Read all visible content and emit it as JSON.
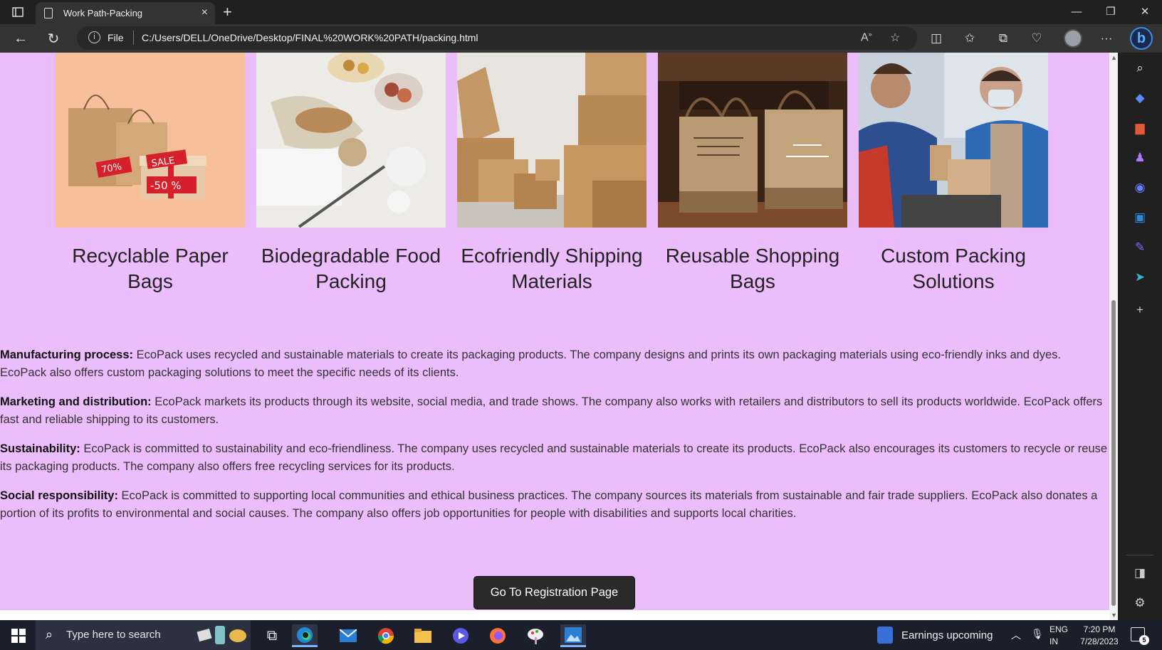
{
  "browser": {
    "tab_title": "Work Path-Packing",
    "scheme_label": "File",
    "url": "C:/Users/DELL/OneDrive/Desktop/FINAL%20WORK%20PATH/packing.html",
    "new_tab_glyph": "+",
    "close_tab_glyph": "×",
    "icons": [
      "tab-actions-icon",
      "back-icon",
      "refresh-icon",
      "info-icon",
      "read-aloud-icon",
      "favorite-star-icon",
      "split-screen-icon",
      "favorites-icon",
      "collections-icon",
      "browser-essentials-icon",
      "profile-avatar",
      "more-icon",
      "bing-copilot-icon"
    ]
  },
  "products": [
    {
      "caption": "Recyclable Paper Bags",
      "image": "paper-bags-sale-image",
      "tag_sale": "SALE",
      "tag_70": "70%",
      "tag_50": "-50 %"
    },
    {
      "caption": "Biodegradable Food Packing",
      "image": "food-packing-image"
    },
    {
      "caption": "Ecofriendly Shipping Materials",
      "image": "cardboard-boxes-image"
    },
    {
      "caption": "Reusable Shopping Bags",
      "image": "jute-shopping-bags-image"
    },
    {
      "caption": "Custom Packing Solutions",
      "image": "workers-packing-image"
    }
  ],
  "sections": [
    {
      "heading": "Manufacturing process:",
      "text": " EcoPack uses recycled and sustainable materials to create its packaging products. The company designs and prints its own packaging materials using eco-friendly inks and dyes. EcoPack also offers custom packaging solutions to meet the specific needs of its clients."
    },
    {
      "heading": "Marketing and distribution:",
      "text": " EcoPack markets its products through its website, social media, and trade shows. The company also works with retailers and distributors to sell its products worldwide. EcoPack offers fast and reliable shipping to its customers."
    },
    {
      "heading": "Sustainability:",
      "text": " EcoPack is committed to sustainability and eco-friendliness. The company uses recycled and sustainable materials to create its products. EcoPack also encourages its customers to recycle or reuse its packaging products. The company also offers free recycling services for its products."
    },
    {
      "heading": "Social responsibility:",
      "text": " EcoPack is committed to supporting local communities and ethical business practices. The company sources its materials from sustainable and fair trade suppliers. EcoPack also donates a portion of its profits to environmental and social causes. The company also offers job opportunities for people with disabilities and supports local charities."
    }
  ],
  "registration_button": "Go To Registration Page",
  "colors": {
    "page_bg": "#ecbdfb",
    "button_bg": "#2a2a2a",
    "browser_chrome": "#333333"
  },
  "sidebar_icons": [
    "search-icon",
    "shopping-tag-icon",
    "tools-icon",
    "games-icon",
    "copilot-icon",
    "outlook-icon",
    "drop-icon",
    "send-icon",
    "add-icon",
    "sidebar-toggle-icon",
    "settings-icon"
  ],
  "taskbar": {
    "search_placeholder": "Type here to search",
    "news_text": "Earnings upcoming",
    "lang_line1": "ENG",
    "lang_line2": "IN",
    "time": "7:20 PM",
    "date": "7/28/2023",
    "notification_count": "5",
    "apps": [
      "task-view-icon",
      "edge-icon",
      "mail-icon",
      "chrome-icon",
      "file-explorer-icon",
      "media-player-icon",
      "firefox-icon",
      "paint-icon",
      "photos-icon"
    ]
  }
}
